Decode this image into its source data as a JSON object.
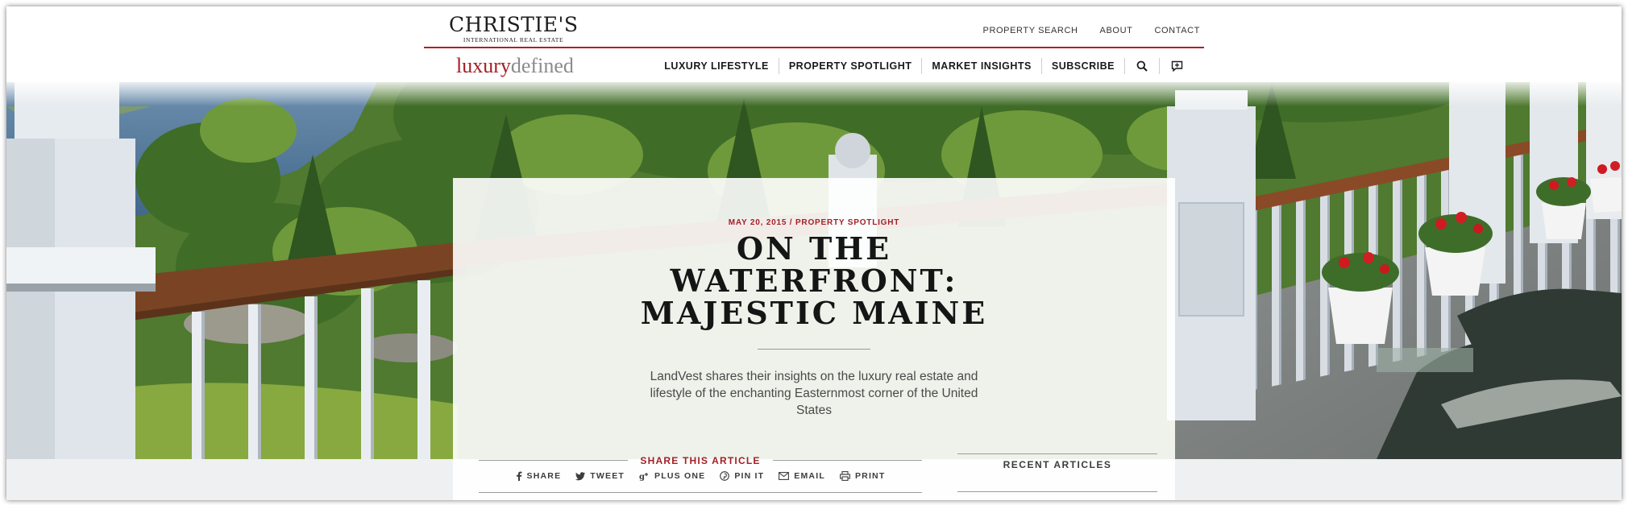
{
  "brand": {
    "name": "CHRISTIE'S",
    "subtitle": "INTERNATIONAL REAL ESTATE"
  },
  "top_nav": [
    "PROPERTY SEARCH",
    "ABOUT",
    "CONTACT"
  ],
  "sub_brand": {
    "part1": "luxury",
    "part2": "defined"
  },
  "main_nav": [
    "LUXURY LIFESTYLE",
    "PROPERTY SPOTLIGHT",
    "MARKET INSIGHTS",
    "SUBSCRIBE"
  ],
  "icons": {
    "search": "search-icon",
    "comment": "comment-icon"
  },
  "article": {
    "meta": "MAY 20, 2015 / PROPERTY SPOTLIGHT",
    "title_lines": [
      "ON THE",
      "WATERFRONT:",
      "MAJESTIC MAINE"
    ],
    "dek": "LandVest shares their insights on the luxury real estate and lifestyle of the enchanting Easternmost corner of the United States"
  },
  "share": {
    "label": "SHARE THIS ARTICLE",
    "items": [
      "SHARE",
      "TWEET",
      "PLUS ONE",
      "PIN IT",
      "EMAIL",
      "PRINT"
    ]
  },
  "recent": {
    "label": "RECENT ARTICLES"
  },
  "colors": {
    "accent": "#a31f25",
    "rule": "#b01e23"
  }
}
